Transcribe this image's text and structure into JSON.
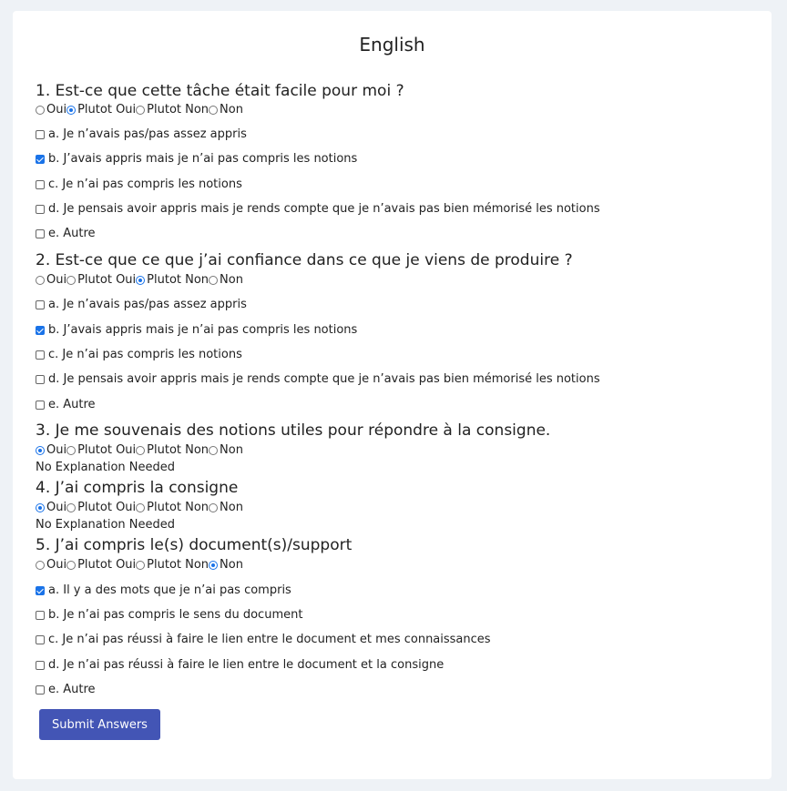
{
  "page": {
    "title": "English"
  },
  "questions": [
    {
      "title": "1. Est-ce que cette tâche était facile pour moi ?",
      "options": [
        "Oui",
        "Plutot Oui",
        "Plutot Non",
        "Non"
      ],
      "selected": 1,
      "reasons": [
        {
          "label": "a. Je n’avais pas/pas assez appris",
          "checked": false
        },
        {
          "label": "b. J’avais appris mais je n’ai pas compris les notions",
          "checked": true
        },
        {
          "label": "c. Je n’ai pas compris les notions",
          "checked": false
        },
        {
          "label": "d. Je pensais avoir appris mais je rends compte que je n’avais pas bien mémorisé les notions",
          "checked": false
        },
        {
          "label": "e. Autre",
          "checked": false
        }
      ]
    },
    {
      "title": "2. Est-ce que ce que j’ai confiance dans ce que je viens de produire ?",
      "options": [
        "Oui",
        "Plutot Oui",
        "Plutot Non",
        "Non"
      ],
      "selected": 2,
      "reasons": [
        {
          "label": "a. Je n’avais pas/pas assez appris",
          "checked": false
        },
        {
          "label": "b. J’avais appris mais je n’ai pas compris les notions",
          "checked": true
        },
        {
          "label": "c. Je n’ai pas compris les notions",
          "checked": false
        },
        {
          "label": "d. Je pensais avoir appris mais je rends compte que je n’avais pas bien mémorisé les notions",
          "checked": false
        },
        {
          "label": "e. Autre",
          "checked": false
        }
      ]
    },
    {
      "title": "3. Je me souvenais des notions utiles pour répondre à la consigne.",
      "options": [
        "Oui",
        "Plutot Oui",
        "Plutot Non",
        "Non"
      ],
      "selected": 0,
      "explanation": "No Explanation Needed"
    },
    {
      "title": "4. J’ai compris la consigne",
      "options": [
        "Oui",
        "Plutot Oui",
        "Plutot Non",
        "Non"
      ],
      "selected": 0,
      "explanation": "No Explanation Needed"
    },
    {
      "title": "5. J’ai compris le(s) document(s)/support",
      "options": [
        "Oui",
        "Plutot Oui",
        "Plutot Non",
        "Non"
      ],
      "selected": 3,
      "reasons": [
        {
          "label": "a. Il y a des mots que je n’ai pas compris",
          "checked": true
        },
        {
          "label": "b. Je n’ai pas compris le sens du document",
          "checked": false
        },
        {
          "label": "c. Je n’ai pas réussi à faire le lien entre le document et mes connaissances",
          "checked": false
        },
        {
          "label": "d. Je n’ai pas réussi à faire le lien entre le document et la consigne",
          "checked": false
        },
        {
          "label": "e. Autre",
          "checked": false
        }
      ]
    }
  ],
  "submit": {
    "label": "Submit Answers"
  },
  "colors": {
    "background": "#eef2f6",
    "accent": "#1a73e8",
    "button": "#4355b5"
  }
}
